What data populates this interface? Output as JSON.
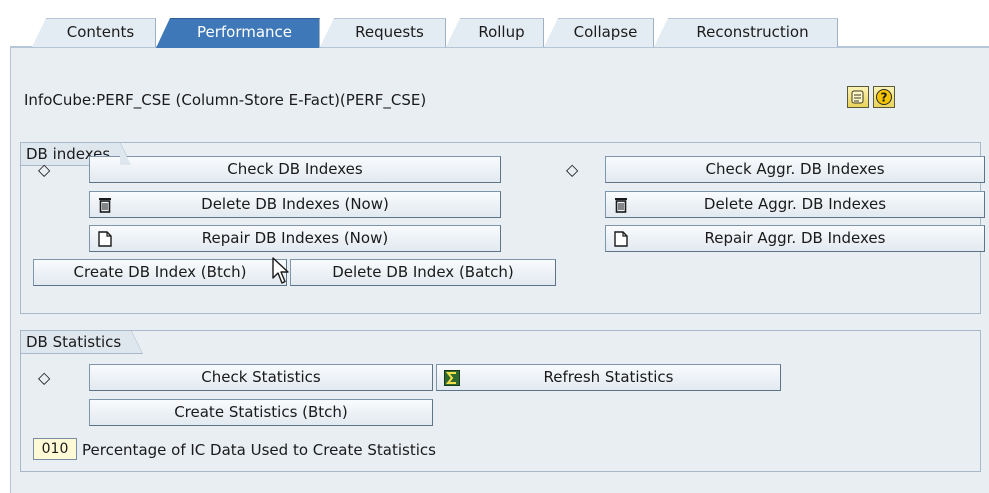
{
  "tabs": [
    {
      "label": "Contents",
      "active": false
    },
    {
      "label": "Performance",
      "active": true
    },
    {
      "label": "Requests",
      "active": false
    },
    {
      "label": "Rollup",
      "active": false
    },
    {
      "label": "Collapse",
      "active": false
    },
    {
      "label": "Reconstruction",
      "active": false
    }
  ],
  "header": {
    "title": "InfoCube:PERF_CSE (Column-Store E-Fact)(PERF_CSE)",
    "icons": [
      "scroll-icon",
      "help-icon"
    ]
  },
  "db_indexes": {
    "group_label": "DB indexes",
    "check_db_indexes": "Check DB Indexes",
    "delete_db_indexes_now": "Delete DB Indexes (Now)",
    "repair_db_indexes_now": "Repair DB Indexes (Now)",
    "create_db_index_batch": "Create DB Index (Btch)",
    "delete_db_index_batch": "Delete DB Index (Batch)",
    "check_aggr_db_indexes": "Check Aggr. DB Indexes",
    "delete_aggr_db_indexes": "Delete Aggr. DB Indexes",
    "repair_aggr_db_indexes": "Repair Aggr. DB Indexes",
    "status_glyph": "◇"
  },
  "db_statistics": {
    "group_label": "DB Statistics",
    "check_statistics": "Check Statistics",
    "refresh_statistics": "Refresh Statistics",
    "create_statistics_batch": "Create Statistics (Btch)",
    "percentage_value": "010",
    "percentage_label": "Percentage of IC Data Used to Create Statistics",
    "status_glyph": "◇"
  },
  "colors": {
    "active_tab": "#3f78b8",
    "panel_bg": "#e9eef3",
    "field_bg": "#fff9d6"
  }
}
